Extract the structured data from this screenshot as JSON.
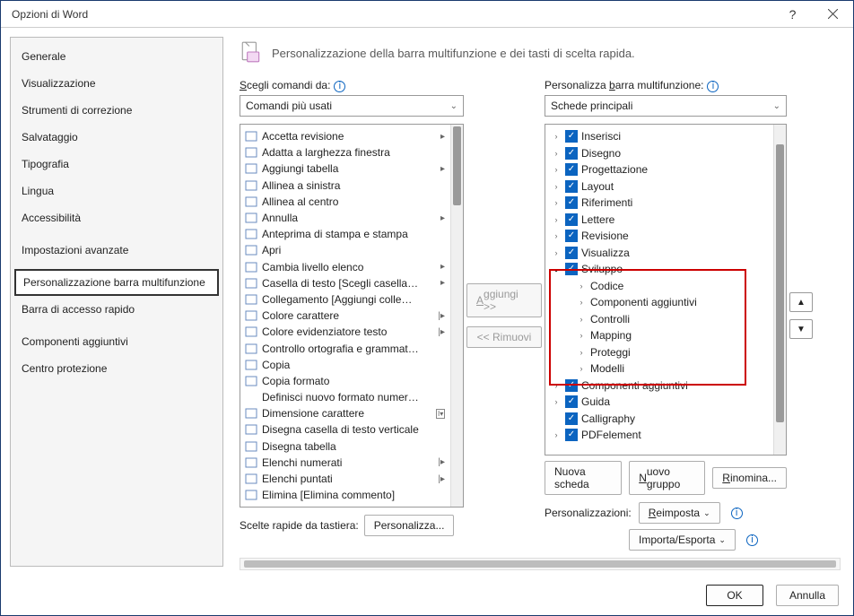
{
  "window": {
    "title": "Opzioni di Word"
  },
  "sidebar": {
    "items": [
      {
        "label": "Generale"
      },
      {
        "label": "Visualizzazione"
      },
      {
        "label": "Strumenti di correzione"
      },
      {
        "label": "Salvataggio"
      },
      {
        "label": "Tipografia"
      },
      {
        "label": "Lingua"
      },
      {
        "label": "Accessibilità"
      },
      {
        "label": "Impostazioni avanzate"
      },
      {
        "label": "Personalizzazione barra multifunzione"
      },
      {
        "label": "Barra di accesso rapido"
      },
      {
        "label": "Componenti aggiuntivi"
      },
      {
        "label": "Centro protezione"
      }
    ],
    "selected_index": 8
  },
  "header": {
    "text": "Personalizzazione della barra multifunzione e dei tasti di scelta rapida."
  },
  "left": {
    "label": "Scegli comandi da:",
    "dropdown": "Comandi più usati",
    "commands": [
      {
        "t": "Accetta revisione",
        "sub": true
      },
      {
        "t": "Adatta a larghezza finestra"
      },
      {
        "t": "Aggiungi tabella",
        "sub": true
      },
      {
        "t": "Allinea a sinistra"
      },
      {
        "t": "Allinea al centro"
      },
      {
        "t": "Annulla",
        "sub": true
      },
      {
        "t": "Anteprima di stampa e stampa"
      },
      {
        "t": "Apri"
      },
      {
        "t": "Cambia livello elenco",
        "sub": true
      },
      {
        "t": "Casella di testo [Scegli casella…",
        "sub": true
      },
      {
        "t": "Collegamento [Aggiungi colle…"
      },
      {
        "t": "Colore carattere",
        "sub": true,
        "split": true
      },
      {
        "t": "Colore evidenziatore testo",
        "sub": true,
        "split": true
      },
      {
        "t": "Controllo ortografia e grammat…"
      },
      {
        "t": "Copia"
      },
      {
        "t": "Copia formato"
      },
      {
        "t": "Definisci nuovo formato numer…",
        "noicon": true
      },
      {
        "t": "Dimensione carattere",
        "field": true
      },
      {
        "t": "Disegna casella di testo verticale"
      },
      {
        "t": "Disegna tabella"
      },
      {
        "t": "Elenchi numerati",
        "sub": true,
        "split": true
      },
      {
        "t": "Elenchi puntati",
        "sub": true,
        "split": true
      },
      {
        "t": "Elimina [Elimina commento]"
      }
    ],
    "shortcut_label": "Scelte rapide da tastiera:",
    "customize_btn": "Personalizza..."
  },
  "middle": {
    "add": "Aggiungi >>",
    "remove": "<< Rimuovi"
  },
  "right": {
    "label": "Personalizza barra multifunzione:",
    "dropdown": "Schede principali",
    "tree": [
      {
        "lvl": 0,
        "arrow": ">",
        "cb": true,
        "label": "Inserisci"
      },
      {
        "lvl": 0,
        "arrow": ">",
        "cb": true,
        "label": "Disegno"
      },
      {
        "lvl": 0,
        "arrow": ">",
        "cb": true,
        "label": "Progettazione"
      },
      {
        "lvl": 0,
        "arrow": ">",
        "cb": true,
        "label": "Layout"
      },
      {
        "lvl": 0,
        "arrow": ">",
        "cb": true,
        "label": "Riferimenti"
      },
      {
        "lvl": 0,
        "arrow": ">",
        "cb": true,
        "label": "Lettere"
      },
      {
        "lvl": 0,
        "arrow": ">",
        "cb": true,
        "label": "Revisione"
      },
      {
        "lvl": 0,
        "arrow": ">",
        "cb": true,
        "label": "Visualizza"
      },
      {
        "lvl": 0,
        "arrow": "v",
        "cb": true,
        "label": "Sviluppo"
      },
      {
        "lvl": 1,
        "arrow": ">",
        "label": "Codice"
      },
      {
        "lvl": 1,
        "arrow": ">",
        "label": "Componenti aggiuntivi"
      },
      {
        "lvl": 1,
        "arrow": ">",
        "label": "Controlli"
      },
      {
        "lvl": 1,
        "arrow": ">",
        "label": "Mapping"
      },
      {
        "lvl": 1,
        "arrow": ">",
        "label": "Proteggi"
      },
      {
        "lvl": 1,
        "arrow": ">",
        "label": "Modelli"
      },
      {
        "lvl": 0,
        "arrow": ">",
        "cb": true,
        "label": "Componenti aggiuntivi"
      },
      {
        "lvl": 0,
        "arrow": ">",
        "cb": true,
        "label": "Guida"
      },
      {
        "lvl": 0,
        "arrow": "",
        "cb": true,
        "label": "Calligraphy"
      },
      {
        "lvl": 0,
        "arrow": ">",
        "cb": true,
        "label": "PDFelement"
      }
    ],
    "btns": {
      "new_tab": "Nuova scheda",
      "new_group": "Nuovo gruppo",
      "rename": "Rinomina..."
    },
    "custom_label": "Personalizzazioni:",
    "reset": "Reimposta",
    "importexport": "Importa/Esporta"
  },
  "footer": {
    "ok": "OK",
    "cancel": "Annulla"
  }
}
